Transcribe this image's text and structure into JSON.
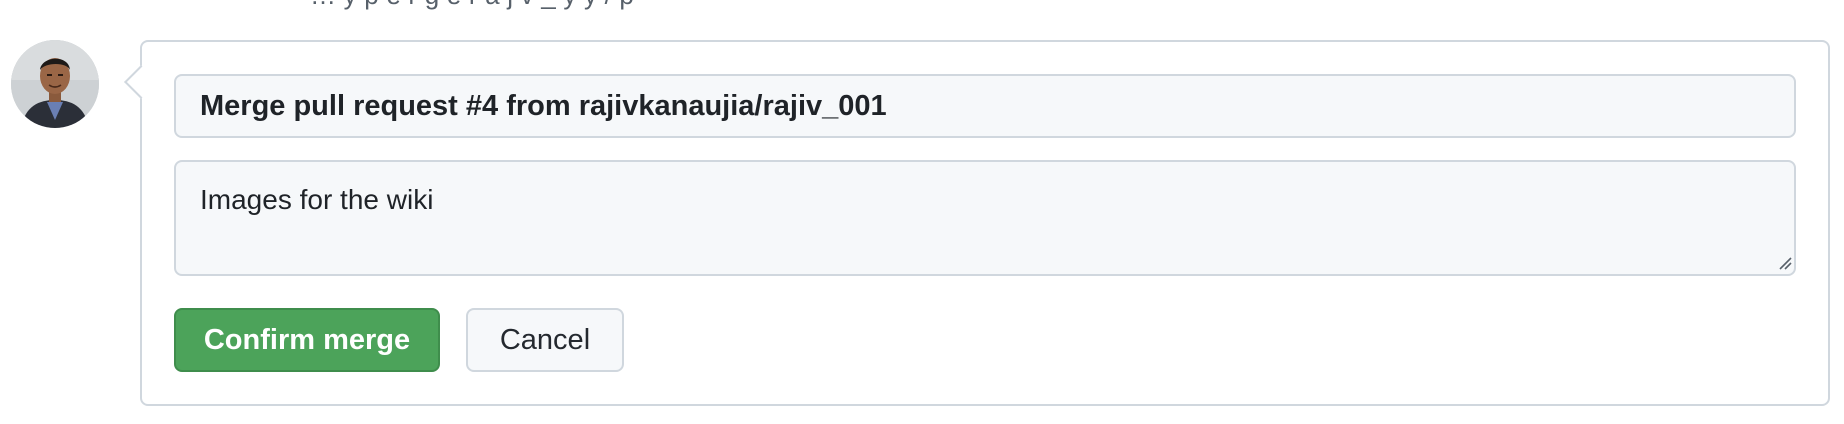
{
  "header_cutoff_text": "… y p e r g e   r a j v _   y   y /   p",
  "avatar": {
    "alt": "user avatar"
  },
  "merge_form": {
    "commit_title": "Merge pull request #4 from rajivkanaujia/rajiv_001",
    "commit_body": "Images for the wiki",
    "confirm_label": "Confirm merge",
    "cancel_label": "Cancel"
  },
  "colors": {
    "confirm_bg": "#4ca35a",
    "border": "#d0d7de",
    "input_bg": "#f6f8fa"
  }
}
